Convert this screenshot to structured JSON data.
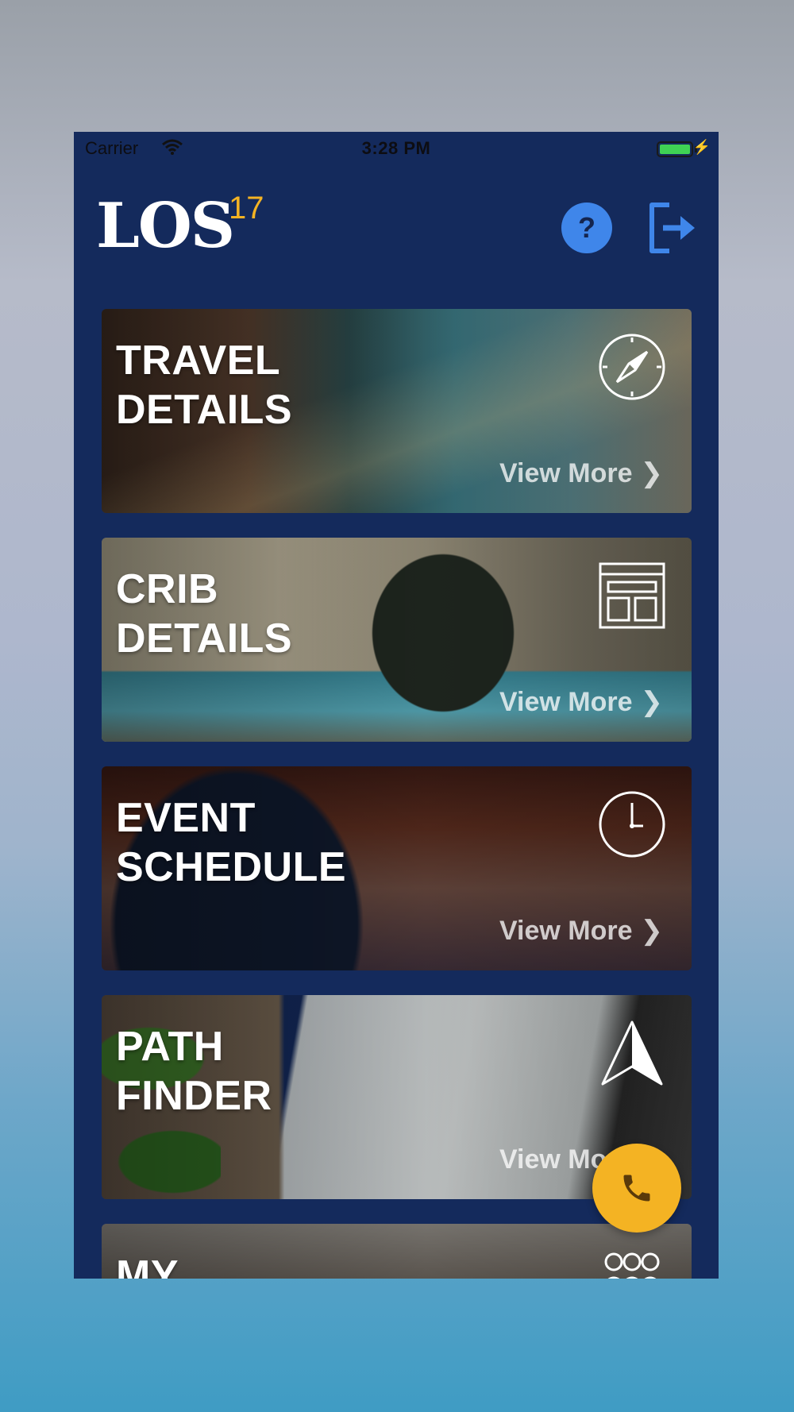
{
  "status_bar": {
    "carrier": "Carrier",
    "time": "3:28 PM",
    "battery_level": 1.0
  },
  "header": {
    "logo_text": "LOS",
    "logo_superscript": "17",
    "help_label": "?"
  },
  "cards": [
    {
      "title_line1": "TRAVEL",
      "title_line2": "DETAILS",
      "action_label": "View More",
      "icon": "compass-icon"
    },
    {
      "title_line1": "CRIB",
      "title_line2": "DETAILS",
      "action_label": "View More",
      "icon": "layout-icon"
    },
    {
      "title_line1": "EVENT",
      "title_line2": "SCHEDULE",
      "action_label": "View More",
      "icon": "clock-icon"
    },
    {
      "title_line1": "PATH",
      "title_line2": "FINDER",
      "action_label": "View More",
      "icon": "navigation-arrow-icon"
    },
    {
      "title_line1": "MY",
      "icon": "group-icon"
    }
  ],
  "colors": {
    "app_background": "#142a5c",
    "accent_yellow": "#f4b323",
    "help_blue": "#3f86ea",
    "battery_green": "#3fd254"
  },
  "fab": {
    "icon": "phone-icon"
  }
}
